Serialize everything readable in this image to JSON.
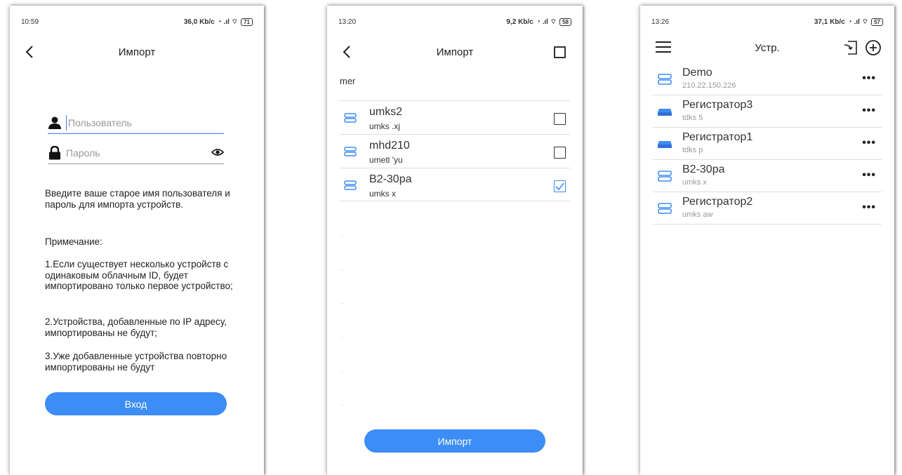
{
  "screen1": {
    "status": {
      "time": "10:59",
      "speed": "36,0 Kb/c",
      "battery": "71"
    },
    "title": "Импорт",
    "username_placeholder": "Пользователь",
    "password_placeholder": "Пароль",
    "info_lines": [
      "Введите ваше старое имя пользователя и пароль для импорта устройств.",
      "   Примечание:",
      "   1.Если существует несколько устройств с одинаковым облачным ID, будет импортировано только первое устройство;",
      "   2.Устройства, добавленные по IP адресу, импортированы не будут;",
      "   3.Уже добавленные устройства повторно импортированы не будут"
    ],
    "login_button": "Вход"
  },
  "screen2": {
    "status": {
      "time": "13:20",
      "speed": "9,2 Kb/c",
      "battery": "58"
    },
    "title": "Импорт",
    "account_label": "mer",
    "devices": [
      {
        "name": "umks2",
        "sub": "umks          .xj",
        "checked": false
      },
      {
        "name": "mhd210",
        "sub": "umetl          'yu",
        "checked": false
      },
      {
        "name": "B2-30pa",
        "sub": "umks           x",
        "checked": true
      }
    ],
    "import_button": "Импорт"
  },
  "screen3": {
    "status": {
      "time": "13:26",
      "speed": "37,1 Kb/c",
      "battery": "57"
    },
    "title": "Устр.",
    "more_glyph": "•••",
    "devices": [
      {
        "name": "Demo",
        "sub": "210.22.150.226",
        "icon": "server-icon"
      },
      {
        "name": "Регистратор3",
        "sub": "tdks          5",
        "icon": "recorder-icon"
      },
      {
        "name": "Регистратор1",
        "sub": "tdks          p",
        "icon": "recorder-icon"
      },
      {
        "name": "B2-30pa",
        "sub": "umks          x",
        "icon": "server-icon"
      },
      {
        "name": "Регистратор2",
        "sub": "umks          aw",
        "icon": "server-icon"
      }
    ]
  },
  "colors": {
    "accent": "#3c8df5",
    "divider": "#dddddd",
    "text": "#222222"
  }
}
